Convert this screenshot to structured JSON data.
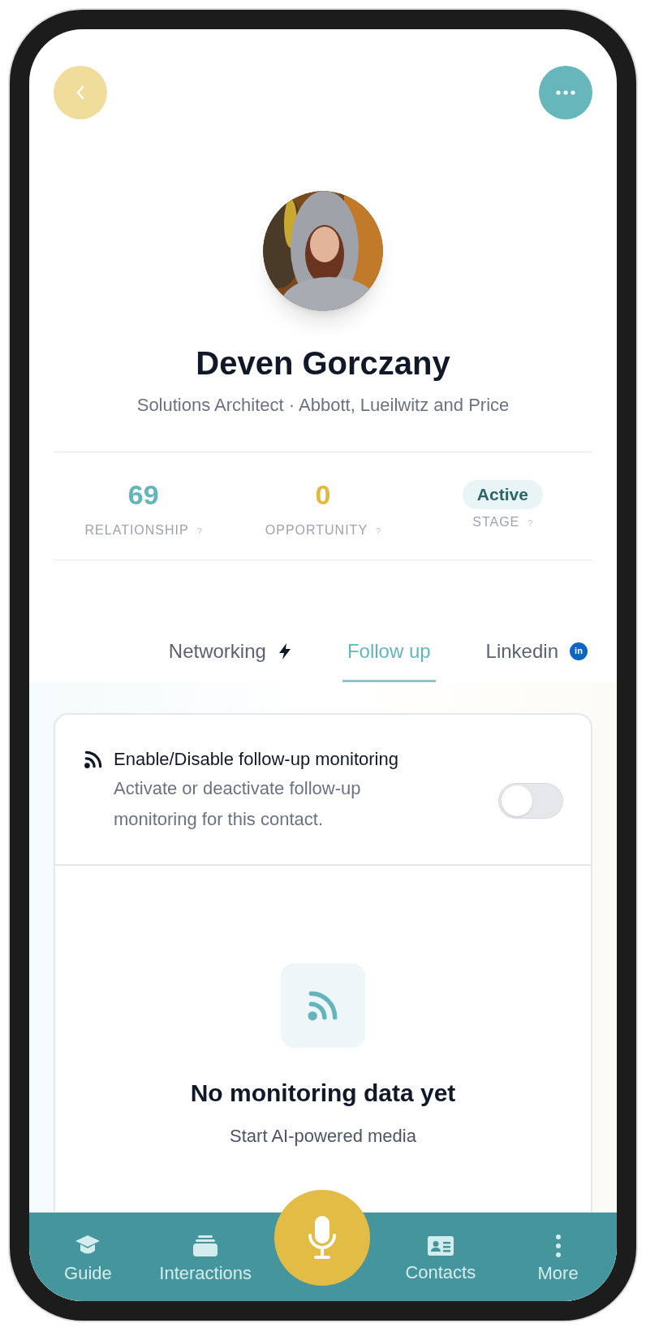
{
  "profile": {
    "name": "Deven Gorczany",
    "subtitle": "Solutions Architect · Abbott, Lueilwitz and Price"
  },
  "stats": [
    {
      "kind": "number",
      "value": "69",
      "label": "RELATIONSHIP",
      "hint": "?",
      "color": "#63b5bb"
    },
    {
      "kind": "number",
      "value": "0",
      "label": "OPPORTUNITY",
      "hint": "?",
      "color": "#e0b93f"
    },
    {
      "kind": "badge",
      "value": "Active",
      "label": "STAGE",
      "hint": "?"
    }
  ],
  "tabs": [
    {
      "label": "Networking",
      "kind": "bolt",
      "selected": false
    },
    {
      "label": "Follow up",
      "kind": "plain",
      "selected": true
    },
    {
      "label": "Linkedin",
      "kind": "linkedin",
      "badge": "in",
      "selected": false
    }
  ],
  "monitoring": {
    "title": "Enable/Disable follow-up monitoring",
    "description": "Activate or deactivate follow-up monitoring for this contact.",
    "on": false
  },
  "empty_state": {
    "title": "No monitoring data yet",
    "text": "Start AI-powered media"
  },
  "nav": [
    {
      "label": "Guide",
      "kind": "guide"
    },
    {
      "label": "Interactions",
      "kind": "stack"
    },
    {
      "kind": "mic"
    },
    {
      "label": "Contacts",
      "kind": "card"
    },
    {
      "label": "More",
      "kind": "more"
    }
  ]
}
